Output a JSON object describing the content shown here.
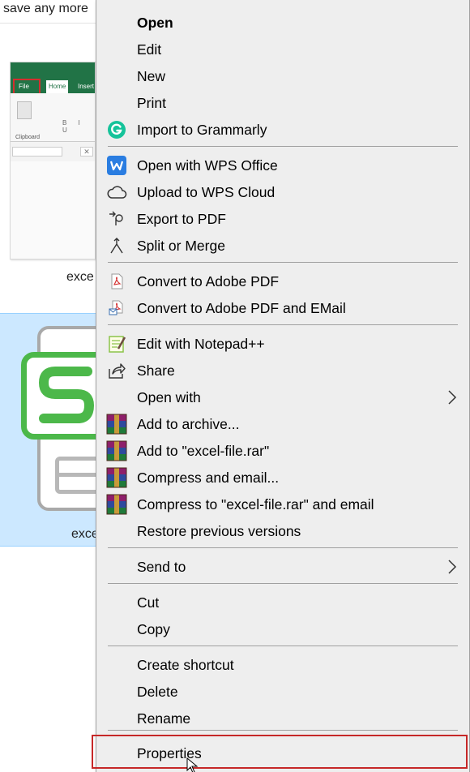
{
  "background": {
    "top_text": "save any more",
    "thumb1": {
      "file_tab": "File",
      "home_tab": "Home",
      "insert_tab": "Insert",
      "paste": "Paste",
      "clipboard": "Clipboard",
      "biu": "B I U",
      "x_label": "✕"
    },
    "label1": "exce",
    "label2": "exce"
  },
  "menu": {
    "items": [
      {
        "label": "Open",
        "bold": true
      },
      {
        "label": "Edit"
      },
      {
        "label": "New"
      },
      {
        "label": "Print"
      },
      {
        "label": "Import to Grammarly",
        "icon": "grammarly-icon"
      },
      {
        "label": "Open with WPS Office",
        "icon": "wps-office-icon"
      },
      {
        "label": "Upload to WPS Cloud",
        "icon": "cloud-icon"
      },
      {
        "label": "Export to PDF",
        "icon": "export-pdf-icon"
      },
      {
        "label": "Split or Merge",
        "icon": "split-merge-icon"
      },
      {
        "label": "Convert to Adobe PDF",
        "icon": "adobe-pdf-icon"
      },
      {
        "label": "Convert to Adobe PDF and EMail",
        "icon": "adobe-pdf-email-icon"
      },
      {
        "label": "Edit with Notepad++",
        "icon": "notepad-plus-plus-icon"
      },
      {
        "label": "Share",
        "icon": "share-icon"
      },
      {
        "label": "Open with",
        "submenu": true
      },
      {
        "label": "Add to archive...",
        "icon": "winrar-icon"
      },
      {
        "label": "Add to \"excel-file.rar\"",
        "icon": "winrar-icon"
      },
      {
        "label": "Compress and email...",
        "icon": "winrar-icon"
      },
      {
        "label": "Compress to \"excel-file.rar\" and email",
        "icon": "winrar-icon"
      },
      {
        "label": "Restore previous versions"
      },
      {
        "label": "Send to",
        "submenu": true
      },
      {
        "label": "Cut"
      },
      {
        "label": "Copy"
      },
      {
        "label": "Create shortcut"
      },
      {
        "label": "Delete"
      },
      {
        "label": "Rename"
      },
      {
        "label": "Properties",
        "highlighted": true
      }
    ]
  },
  "colors": {
    "menu_bg": "#eeeeee",
    "separator": "#a0a0a0",
    "highlight_border": "#c62828",
    "selection_bg": "#cce8ff",
    "grammarly_green": "#15c39a",
    "wps_blue": "#2a7de1",
    "excel_green": "#217346",
    "wps_green": "#4cb84a"
  }
}
